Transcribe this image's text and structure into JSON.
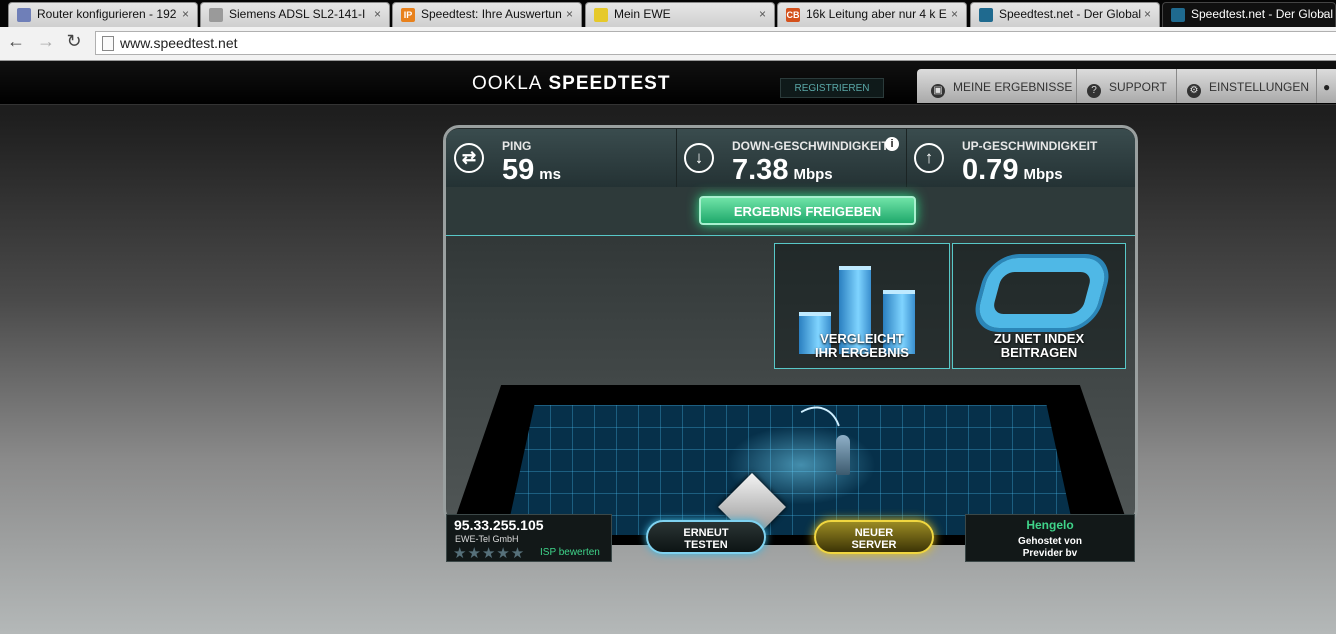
{
  "browser": {
    "tabs": [
      {
        "title": "Router konfigurieren - 192",
        "favicon": "router-favicon",
        "color": "#6f7fb8"
      },
      {
        "title": "Siemens ADSL SL2-141-I",
        "favicon": "document-favicon",
        "color": "#9a9a9a"
      },
      {
        "title": "Speedtest: Ihre Auswertun",
        "favicon": "ip-favicon",
        "color": "#e8811c",
        "glyph": "IP"
      },
      {
        "title": "Mein EWE",
        "favicon": "ewe-favicon",
        "color": "#e6c92a"
      },
      {
        "title": "16k Leitung aber nur 4 k E",
        "favicon": "cb-favicon",
        "color": "#d4511c",
        "glyph": "CB"
      },
      {
        "title": "Speedtest.net - Der Global",
        "favicon": "speedtest-favicon",
        "color": "#1f6a8f"
      },
      {
        "title": "Speedtest.net - Der Global",
        "favicon": "speedtest-favicon",
        "color": "#1f6a8f",
        "active": true
      }
    ],
    "url": "www.speedtest.net"
  },
  "header": {
    "logo": "OOKLA",
    "logo_sub": "SPEEDTEST",
    "register": "REGISTRIEREN",
    "nav": [
      {
        "label": "MEINE ERGEBNISSE",
        "icon": "camera-icon"
      },
      {
        "label": "SUPPORT",
        "icon": "question-icon"
      },
      {
        "label": "EINSTELLUNGEN",
        "icon": "gear-icon"
      }
    ]
  },
  "results": {
    "ping": {
      "label": "PING",
      "value": "59",
      "unit": "ms"
    },
    "download": {
      "label": "DOWN-GESCHWINDIGKEIT",
      "value": "7.38",
      "unit": "Mbps"
    },
    "upload": {
      "label": "UP-GESCHWINDIGKEIT",
      "value": "0.79",
      "unit": "Mbps"
    },
    "share": "ERGEBNIS FREIGEBEN"
  },
  "panels": {
    "compare": [
      "VERGLEICHT",
      "IHR ERGEBNIS"
    ],
    "netindex": [
      "ZU NET INDEX",
      "BEITRAGEN"
    ]
  },
  "bottom": {
    "ip": "95.33.255.105",
    "isp": "EWE-Tel GmbH",
    "rating_stars": "★★★★★",
    "rate_isp": "ISP bewerten",
    "retry": [
      "ERNEUT",
      "TESTEN"
    ],
    "new_server": [
      "NEUER",
      "SERVER"
    ],
    "server_city": "Hengelo",
    "hosted_by": [
      "Gehostet von",
      "Previder bv"
    ]
  }
}
